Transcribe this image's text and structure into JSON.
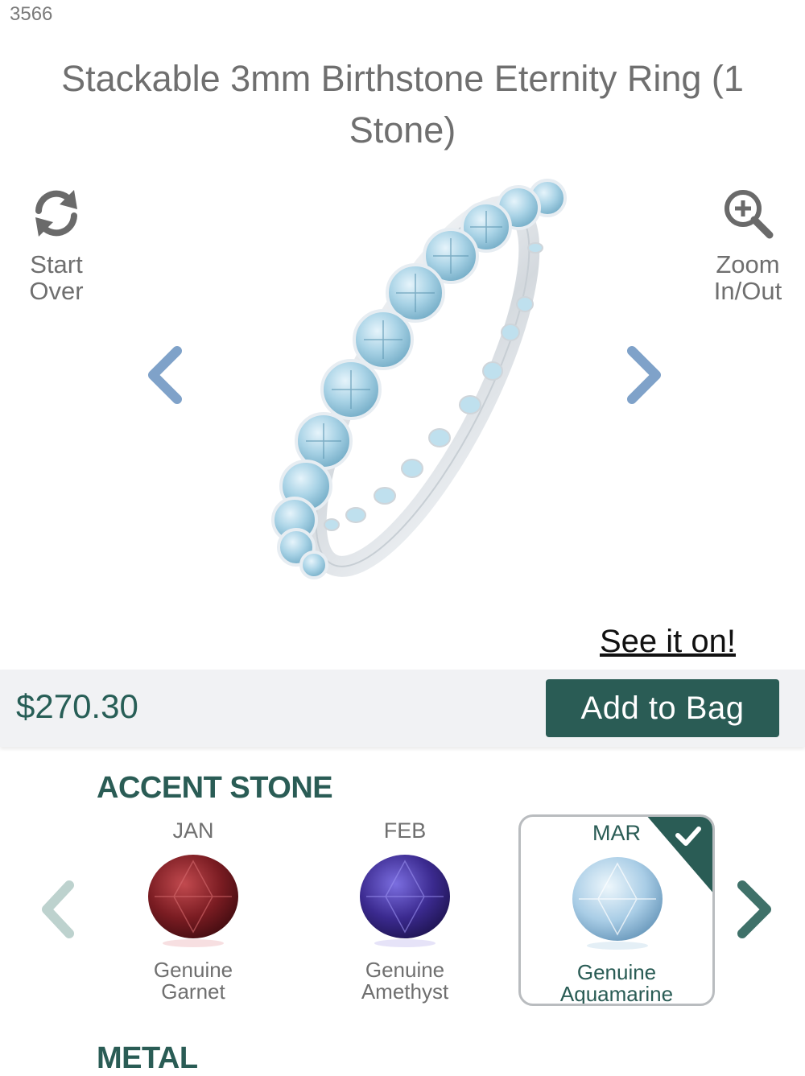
{
  "sku": "3566",
  "product": {
    "title": "Stackable 3mm Birthstone Eternity Ring (1 Stone)"
  },
  "toolbar": {
    "start_over_line1": "Start",
    "start_over_line2": "Over",
    "zoom_line1": "Zoom",
    "zoom_line2": "In/Out"
  },
  "see_it_on": "See it on!",
  "purchase": {
    "price": "$270.30",
    "add_to_bag": "Add to Bag"
  },
  "accent_stone": {
    "heading": "ACCENT STONE",
    "options": [
      {
        "month": "JAN",
        "name_line1": "Genuine",
        "name_line2": "Garnet",
        "color": "#7a1c22",
        "selected": false
      },
      {
        "month": "FEB",
        "name_line1": "Genuine",
        "name_line2": "Amethyst",
        "color": "#3b2a8f",
        "selected": false
      },
      {
        "month": "MAR",
        "name_line1": "Genuine",
        "name_line2": "Aquamarine",
        "color": "#a9cde6",
        "selected": true
      }
    ]
  },
  "metal": {
    "heading": "METAL"
  },
  "colors": {
    "brand_green": "#2a5c55",
    "nav_blue": "#7fa2c9",
    "price_bar": "#f1f2f4"
  }
}
